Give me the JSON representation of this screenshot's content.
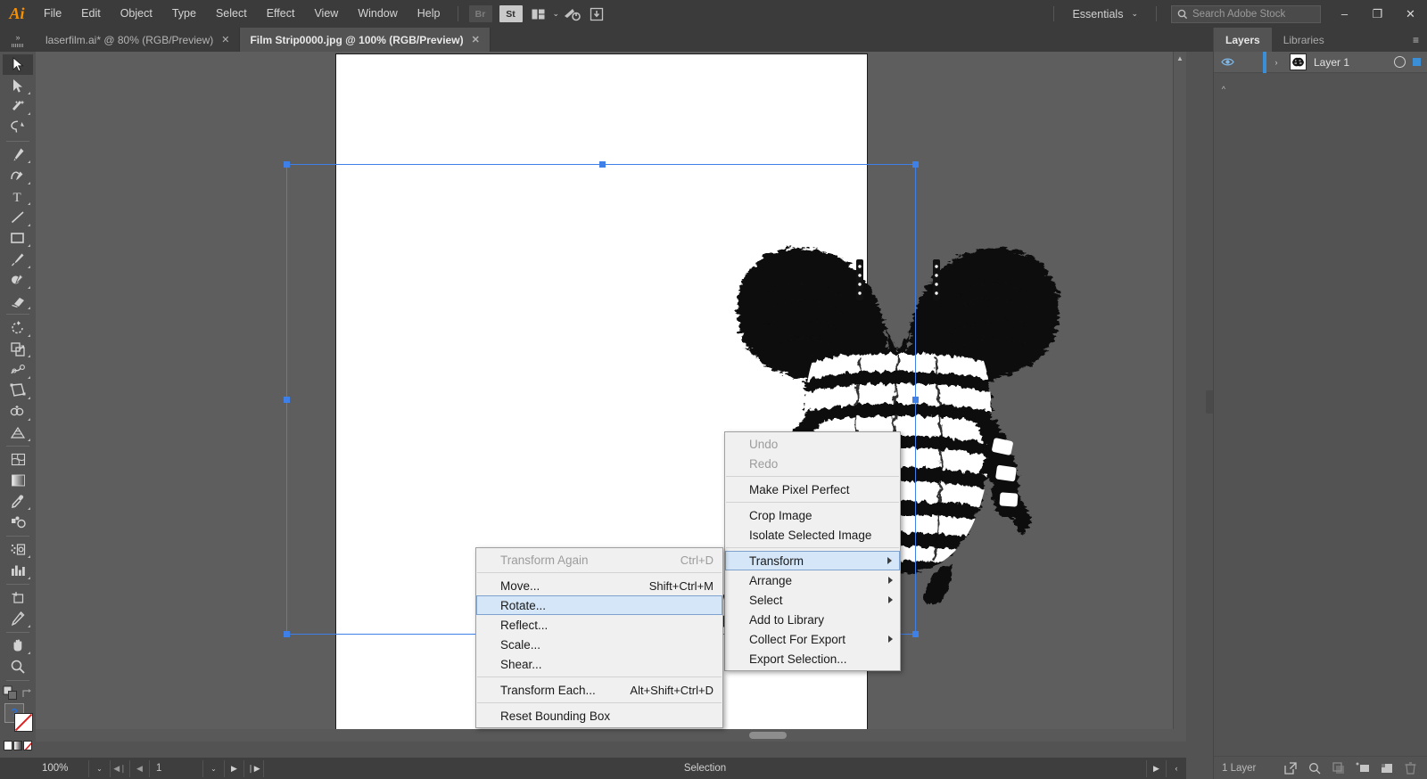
{
  "app": {
    "name": "Adobe Illustrator",
    "logo": "Ai"
  },
  "menubar": {
    "items": [
      "File",
      "Edit",
      "Object",
      "Type",
      "Select",
      "Effect",
      "View",
      "Window",
      "Help"
    ],
    "bridge_label": "Br",
    "stock_label": "St",
    "arrange_icon": "arrange-documents-icon",
    "chevron": "⌄",
    "extra_icons": [
      "rocket-icon",
      "hand-pointer-icon"
    ],
    "workspace": "Essentials",
    "workspace_chevron": "⌄",
    "search_placeholder": "Search Adobe Stock",
    "search_value": "",
    "window_buttons": {
      "minimize": "–",
      "restore": "❐",
      "close": "✕"
    }
  },
  "tabs": [
    {
      "label": "laserfilm.ai* @ 80% (RGB/Preview)",
      "close": "✕",
      "active": false
    },
    {
      "label": "Film Strip0000.jpg @ 100% (RGB/Preview)",
      "close": "✕",
      "active": true
    }
  ],
  "toolbar": {
    "tools": [
      {
        "name": "selection-tool",
        "glyph": "selection",
        "selected": true,
        "corner": false
      },
      {
        "name": "direct-selection-tool",
        "glyph": "direct-selection",
        "selected": false,
        "corner": true
      },
      {
        "name": "magic-wand-tool",
        "glyph": "magic-wand",
        "selected": false,
        "corner": true
      },
      {
        "name": "lasso-tool",
        "glyph": "lasso",
        "selected": false,
        "corner": false
      },
      {
        "sep": true
      },
      {
        "name": "pen-tool",
        "glyph": "pen",
        "selected": false,
        "corner": true
      },
      {
        "name": "curvature-tool",
        "glyph": "curvature",
        "selected": false,
        "corner": true
      },
      {
        "name": "type-tool",
        "glyph": "type",
        "selected": false,
        "corner": true
      },
      {
        "name": "line-segment-tool",
        "glyph": "line",
        "selected": false,
        "corner": true
      },
      {
        "name": "rectangle-tool",
        "glyph": "rectangle",
        "selected": false,
        "corner": true
      },
      {
        "name": "paintbrush-tool",
        "glyph": "paintbrush",
        "selected": false,
        "corner": true
      },
      {
        "name": "shaper-tool",
        "glyph": "shaper",
        "selected": false,
        "corner": true
      },
      {
        "name": "eraser-tool",
        "glyph": "eraser",
        "selected": false,
        "corner": true
      },
      {
        "sep": true
      },
      {
        "name": "rotate-tool",
        "glyph": "rotate",
        "selected": false,
        "corner": true
      },
      {
        "name": "scale-tool",
        "glyph": "scale",
        "selected": false,
        "corner": true
      },
      {
        "name": "width-tool",
        "glyph": "width",
        "selected": false,
        "corner": true
      },
      {
        "name": "free-transform-tool",
        "glyph": "free-transform",
        "selected": false,
        "corner": true
      },
      {
        "name": "shape-builder-tool",
        "glyph": "shape-builder",
        "selected": false,
        "corner": true
      },
      {
        "name": "perspective-grid-tool",
        "glyph": "perspective-grid",
        "selected": false,
        "corner": true
      },
      {
        "sep": true
      },
      {
        "name": "mesh-tool",
        "glyph": "mesh",
        "selected": false,
        "corner": false
      },
      {
        "name": "gradient-tool",
        "glyph": "gradient",
        "selected": false,
        "corner": false
      },
      {
        "name": "eyedropper-tool",
        "glyph": "eyedropper",
        "selected": false,
        "corner": true
      },
      {
        "name": "blend-tool",
        "glyph": "blend",
        "selected": false,
        "corner": false
      },
      {
        "sep": true
      },
      {
        "name": "symbol-sprayer-tool",
        "glyph": "symbol-sprayer",
        "selected": false,
        "corner": true
      },
      {
        "name": "column-graph-tool",
        "glyph": "column-graph",
        "selected": false,
        "corner": true
      },
      {
        "sep": true
      },
      {
        "name": "artboard-tool",
        "glyph": "artboard",
        "selected": false,
        "corner": false
      },
      {
        "name": "slice-tool",
        "glyph": "slice",
        "selected": false,
        "corner": true
      },
      {
        "sep": true
      },
      {
        "name": "hand-tool",
        "glyph": "hand",
        "selected": false,
        "corner": true
      },
      {
        "name": "zoom-tool",
        "glyph": "zoom",
        "selected": false,
        "corner": false
      }
    ],
    "fill_color": "#ffffff",
    "stroke_color": "none",
    "question_glyph": "?",
    "screen_mode_icon": "screen-mode-icon"
  },
  "canvas": {
    "artboard_background": "#ffffff",
    "pasteboard_color": "#5e5e5e",
    "selection_color": "#3e7fe8",
    "artwork_alt": "high-contrast black and white engraving of an insect thorax"
  },
  "context_menu": {
    "main": [
      {
        "label": "Undo",
        "disabled": true,
        "shortcut": "",
        "submenu": false,
        "highlight": false
      },
      {
        "label": "Redo",
        "disabled": true,
        "shortcut": "",
        "submenu": false,
        "highlight": false
      },
      {
        "separator": true
      },
      {
        "label": "Make Pixel Perfect",
        "disabled": false,
        "shortcut": "",
        "submenu": false,
        "highlight": false
      },
      {
        "separator": true
      },
      {
        "label": "Crop Image",
        "disabled": false,
        "shortcut": "",
        "submenu": false,
        "highlight": false
      },
      {
        "label": "Isolate Selected Image",
        "disabled": false,
        "shortcut": "",
        "submenu": false,
        "highlight": false
      },
      {
        "separator": true
      },
      {
        "label": "Transform",
        "disabled": false,
        "shortcut": "",
        "submenu": true,
        "highlight": true
      },
      {
        "label": "Arrange",
        "disabled": false,
        "shortcut": "",
        "submenu": true,
        "highlight": false
      },
      {
        "label": "Select",
        "disabled": false,
        "shortcut": "",
        "submenu": true,
        "highlight": false
      },
      {
        "label": "Add to Library",
        "disabled": false,
        "shortcut": "",
        "submenu": false,
        "highlight": false
      },
      {
        "label": "Collect For Export",
        "disabled": false,
        "shortcut": "",
        "submenu": true,
        "highlight": false
      },
      {
        "label": "Export Selection...",
        "disabled": false,
        "shortcut": "",
        "submenu": false,
        "highlight": false
      }
    ],
    "submenu": [
      {
        "label": "Transform Again",
        "disabled": true,
        "shortcut": "Ctrl+D",
        "submenu": false,
        "highlight": false
      },
      {
        "separator": true
      },
      {
        "label": "Move...",
        "disabled": false,
        "shortcut": "Shift+Ctrl+M",
        "submenu": false,
        "highlight": false
      },
      {
        "label": "Rotate...",
        "disabled": false,
        "shortcut": "",
        "submenu": false,
        "highlight": true
      },
      {
        "label": "Reflect...",
        "disabled": false,
        "shortcut": "",
        "submenu": false,
        "highlight": false
      },
      {
        "label": "Scale...",
        "disabled": false,
        "shortcut": "",
        "submenu": false,
        "highlight": false
      },
      {
        "label": "Shear...",
        "disabled": false,
        "shortcut": "",
        "submenu": false,
        "highlight": false
      },
      {
        "separator": true
      },
      {
        "label": "Transform Each...",
        "disabled": false,
        "shortcut": "Alt+Shift+Ctrl+D",
        "submenu": false,
        "highlight": false
      },
      {
        "separator": true
      },
      {
        "label": "Reset Bounding Box",
        "disabled": false,
        "shortcut": "",
        "submenu": false,
        "highlight": false
      }
    ]
  },
  "statusbar": {
    "zoom": "100%",
    "zoom_chevron": "⌄",
    "first_page_icon": "◀❘",
    "prev_page_icon": "◀",
    "page": "1",
    "page_chevron": "⌄",
    "next_page_icon": "▶",
    "last_page_icon": "❘▶",
    "tool_label": "Selection",
    "expand_icon": "▶",
    "collapse_icon": "‹"
  },
  "panels": {
    "tabs": [
      {
        "label": "Layers",
        "active": true
      },
      {
        "label": "Libraries",
        "active": false
      }
    ],
    "menu_icon": "≡",
    "layers": [
      {
        "name": "Layer 1",
        "visible": true,
        "locked": false,
        "color": "#3a8fd6",
        "expand_icon": "›",
        "eye_icon": "eye-icon",
        "target_icon": "target-circle-icon",
        "selected": true
      }
    ],
    "footer": {
      "count_label": "1 Layer",
      "icons": [
        "locate-object-icon",
        "make-clipping-mask-icon",
        "create-new-sublayer-icon",
        "create-new-layer-icon",
        "delete-selection-icon"
      ]
    }
  }
}
